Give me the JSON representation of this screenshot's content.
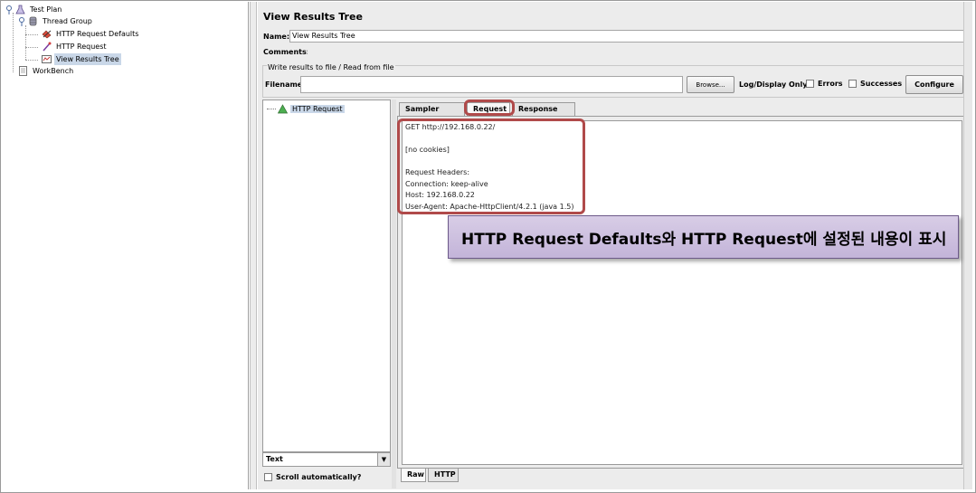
{
  "tree": {
    "items": [
      {
        "label": "Test Plan",
        "icon": "test-plan-icon"
      },
      {
        "label": "Thread Group",
        "icon": "thread-group-icon"
      },
      {
        "label": "HTTP Request Defaults",
        "icon": "config-element-icon"
      },
      {
        "label": "HTTP Request",
        "icon": "sampler-icon"
      },
      {
        "label": "View Results Tree",
        "icon": "listener-icon"
      },
      {
        "label": "WorkBench",
        "icon": "workbench-icon"
      }
    ],
    "selected": "View Results Tree"
  },
  "panel": {
    "title": "View Results Tree",
    "name_label": "Name:",
    "name_value": "View Results Tree",
    "comments_label": "Comments:",
    "write_group_label": "Write results to file / Read from file",
    "filename_label": "Filename",
    "browse_label": "Browse...",
    "log_display_label": "Log/Display Only:",
    "errors_label": "Errors",
    "successes_label": "Successes",
    "configure_label": "Configure"
  },
  "results": {
    "items": [
      {
        "label": "HTTP Request",
        "status": "success"
      }
    ],
    "renderer_value": "Text",
    "scroll_auto_label": "Scroll automatically?"
  },
  "tabs": {
    "items": [
      "Sampler result",
      "Request",
      "Response data"
    ],
    "active": "Request",
    "bottom": [
      "Raw",
      "HTTP"
    ],
    "bottom_active": "Raw"
  },
  "request_text": {
    "lines": [
      "GET http://192.168.0.22/",
      "",
      "[no cookies]",
      "",
      "Request Headers:",
      "Connection: keep-alive",
      "Host: 192.168.0.22",
      "User-Agent: Apache-HttpClient/4.2.1 (java 1.5)"
    ]
  },
  "callout": {
    "text": "HTTP Request Defaults와 HTTP Request에 설정된 내용이 표시"
  },
  "colors": {
    "highlight": "#b04a4a",
    "callout_bg": "#c9bbdd",
    "selection": "#c9d7e8"
  }
}
